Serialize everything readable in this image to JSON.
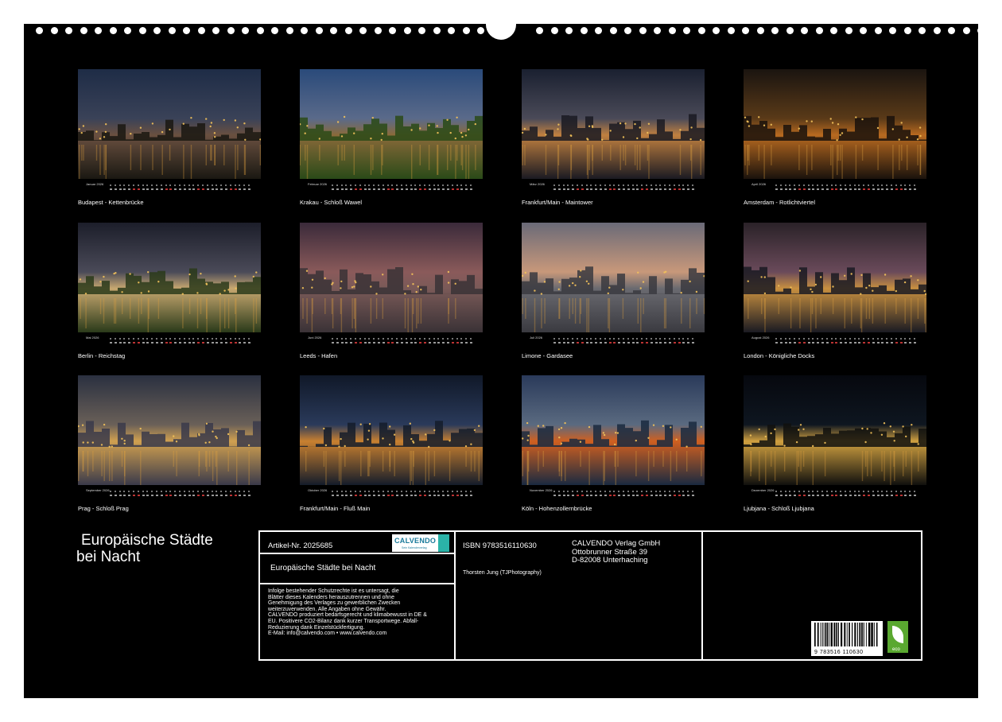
{
  "months": [
    {
      "label": "Januar 2026",
      "caption": "Budapest - Kettenbrücke"
    },
    {
      "label": "Februar 2026",
      "caption": "Krakau - Schloß Wawel"
    },
    {
      "label": "März 2026",
      "caption": "Frankfurt/Main - Maintower"
    },
    {
      "label": "April 2026",
      "caption": "Amsterdam - Rotlichtviertel"
    },
    {
      "label": "Mai 2026",
      "caption": "Berlin - Reichstag"
    },
    {
      "label": "Juni 2026",
      "caption": "Leeds - Hafen"
    },
    {
      "label": "Juli 2026",
      "caption": "Limone - Gardasee"
    },
    {
      "label": "August 2026",
      "caption": "London - Königliche Docks"
    },
    {
      "label": "September 2026",
      "caption": "Prag - Schloß Prag"
    },
    {
      "label": "Oktober 2026",
      "caption": "Frankfurt/Main - Fluß Main"
    },
    {
      "label": "November 2026",
      "caption": "Köln - Hohenzollernbrücke"
    },
    {
      "label": "Dezember 2026",
      "caption": "Ljubjana - Schloß Ljubjana"
    }
  ],
  "title_line1": "Europäische Städte",
  "title_line2": "bei Nacht",
  "info": {
    "article": "Artikel-Nr. 2025685",
    "logo_text": "CALVENDO",
    "logo_sub": "Sein Kalenderverlag",
    "product_title": "Europäische Städte bei Nacht",
    "disclaimer": [
      "Infolge bestehender Schutzrechte ist es untersagt, die",
      "Blätter dieses Kalenders herauszutrennen und ohne",
      "Genehmigung des Verlages zu gewerblichen Zwecken",
      "weiterzuverwenden. Alle Angaben ohne Gewähr.",
      "CALVENDO produziert bedarfsgerecht und klimabewusst in DE &",
      "EU. Positivere CO2-Bilanz dank kurzer Transportwege. Abfall-",
      "Reduzierung dank Einzelstückfertigung.",
      "E-Mail: info@calvendo.com • www.calvendo.com"
    ],
    "isbn": "ISBN 9783516110630",
    "author": "Thorsten Jung (TJPhotography)",
    "publisher": [
      "CALVENDO Verlag GmbH",
      "Ottobrunner Straße 39",
      "D-82008 Unterhaching"
    ],
    "barcode_number": "9 783516 110630",
    "eco_label": "eco"
  },
  "photo_palettes": [
    [
      "#1e2c46",
      "#3a4258",
      "#6a5040",
      "#1a1812"
    ],
    [
      "#2a4a7a",
      "#5a6a8a",
      "#8a6a3a",
      "#2a4a18"
    ],
    [
      "#1a2030",
      "#4a4a58",
      "#c08040",
      "#1a1a22"
    ],
    [
      "#1a1410",
      "#5a3a18",
      "#b86a20",
      "#1a120c"
    ],
    [
      "#1c1e2a",
      "#4a4a58",
      "#c8a870",
      "#2a3a1a"
    ],
    [
      "#3a2a3a",
      "#8a5a5a",
      "#7a5a58",
      "#3a3236"
    ],
    [
      "#6a6a78",
      "#c8987a",
      "#6a6a70",
      "#3a3a40"
    ],
    [
      "#2a2228",
      "#6a4a5a",
      "#c89040",
      "#1a1a22"
    ],
    [
      "#2a3040",
      "#6a6058",
      "#d0a050",
      "#3a3a4a"
    ],
    [
      "#101828",
      "#2a3a5a",
      "#c88030",
      "#141c2a"
    ],
    [
      "#2a3a5a",
      "#5a6a80",
      "#d06020",
      "#1a2a40"
    ],
    [
      "#06080e",
      "#0e1620",
      "#d0a040",
      "#10100e"
    ]
  ]
}
